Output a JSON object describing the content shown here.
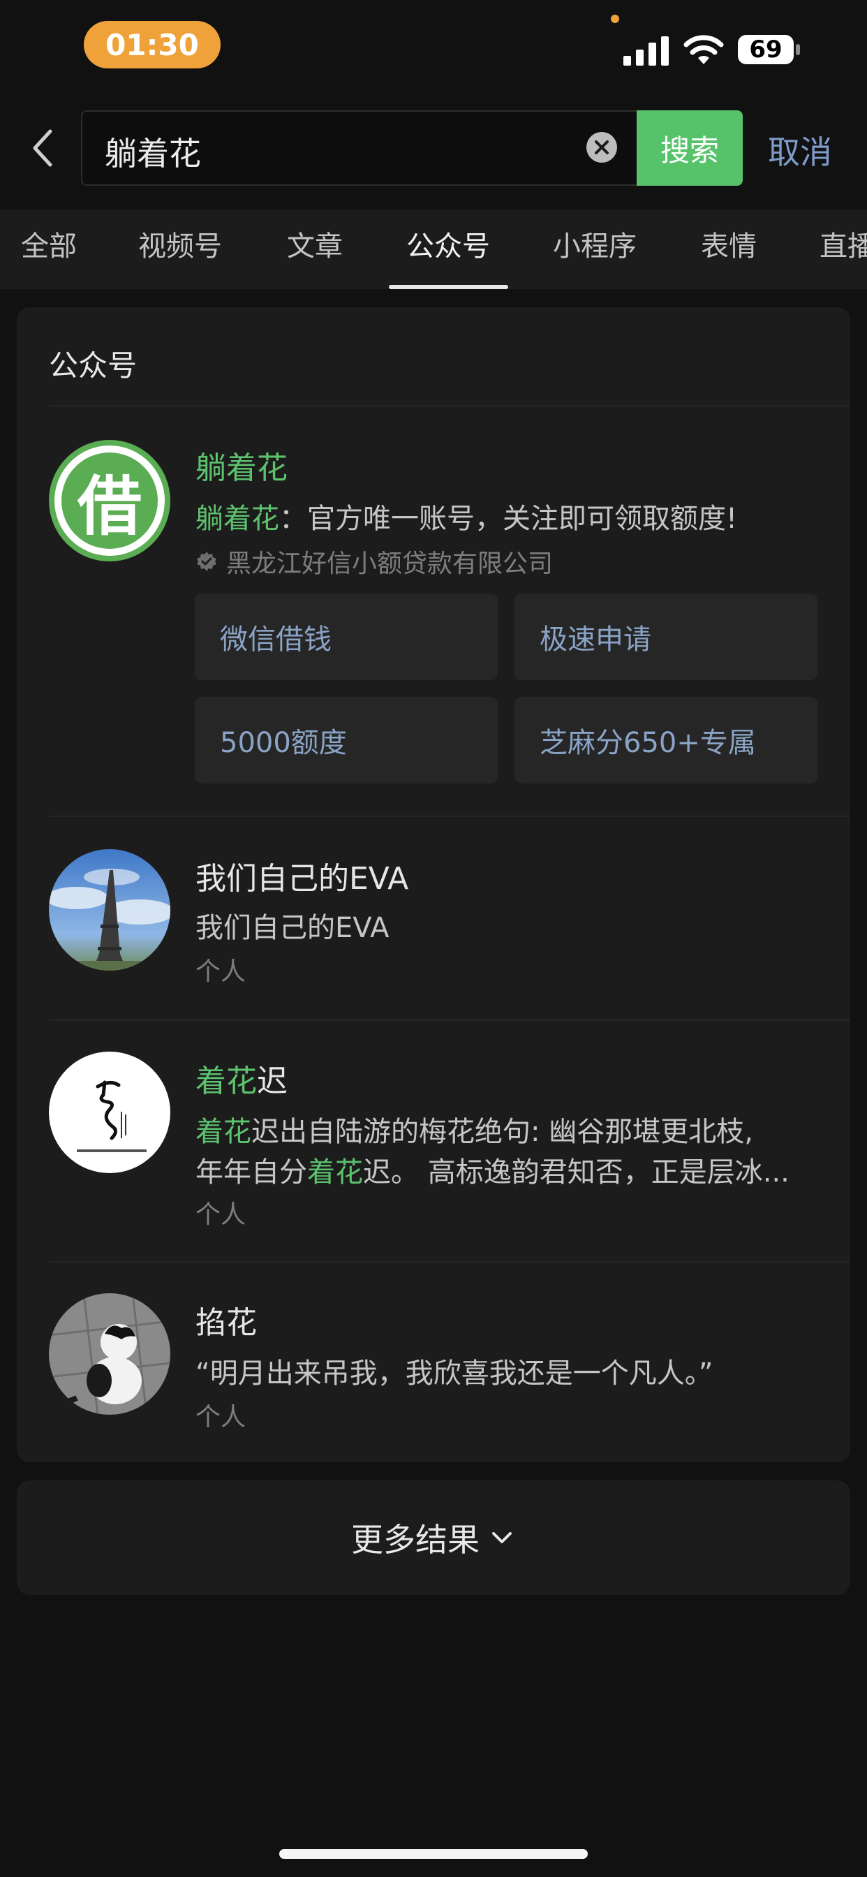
{
  "status_bar": {
    "time": "01:30",
    "battery": "69"
  },
  "search": {
    "query": "躺着花",
    "search_button": "搜索",
    "cancel": "取消"
  },
  "tabs": [
    {
      "label": "全部"
    },
    {
      "label": "视频号"
    },
    {
      "label": "文章"
    },
    {
      "label": "公众号"
    },
    {
      "label": "小程序"
    },
    {
      "label": "表情"
    },
    {
      "label": "直播"
    }
  ],
  "active_tab": "公众号",
  "section": {
    "title": "公众号"
  },
  "results": [
    {
      "name_highlight": "躺着花",
      "name_rest": "",
      "desc_highlight": "躺着花",
      "desc_rest": "：官方唯一账号，关注即可领取额度!",
      "avatar_glyph": "借",
      "verified_org": "黑龙江好信小额贷款有限公司",
      "quick_links": [
        "微信借钱",
        "极速申请",
        "5000额度",
        "芝麻分650+专属"
      ]
    },
    {
      "name": "我们自己的EVA",
      "desc": "我们自己的EVA",
      "type": "个人"
    },
    {
      "name_highlight": "着花",
      "name_rest": "迟",
      "desc_line1_highlight": "着花",
      "desc_line1_rest": "迟出自陆游的梅花绝句: 幽谷那堪更北枝,",
      "desc_line2_pre": "年年自分",
      "desc_line2_highlight": "着花",
      "desc_line2_post": "迟。 高标逸韵君知否，正是层冰...",
      "type": "个人"
    },
    {
      "name": "掐花",
      "desc": "“明月出来吊我，我欣喜我还是一个凡人。”",
      "type": "个人"
    }
  ],
  "more_results": "更多结果",
  "colors": {
    "background": "#111111",
    "card": "#1c1c1c",
    "accent_green": "#56c36b",
    "link_blue": "#7f9bc9",
    "status_orange": "#f0a23a"
  }
}
